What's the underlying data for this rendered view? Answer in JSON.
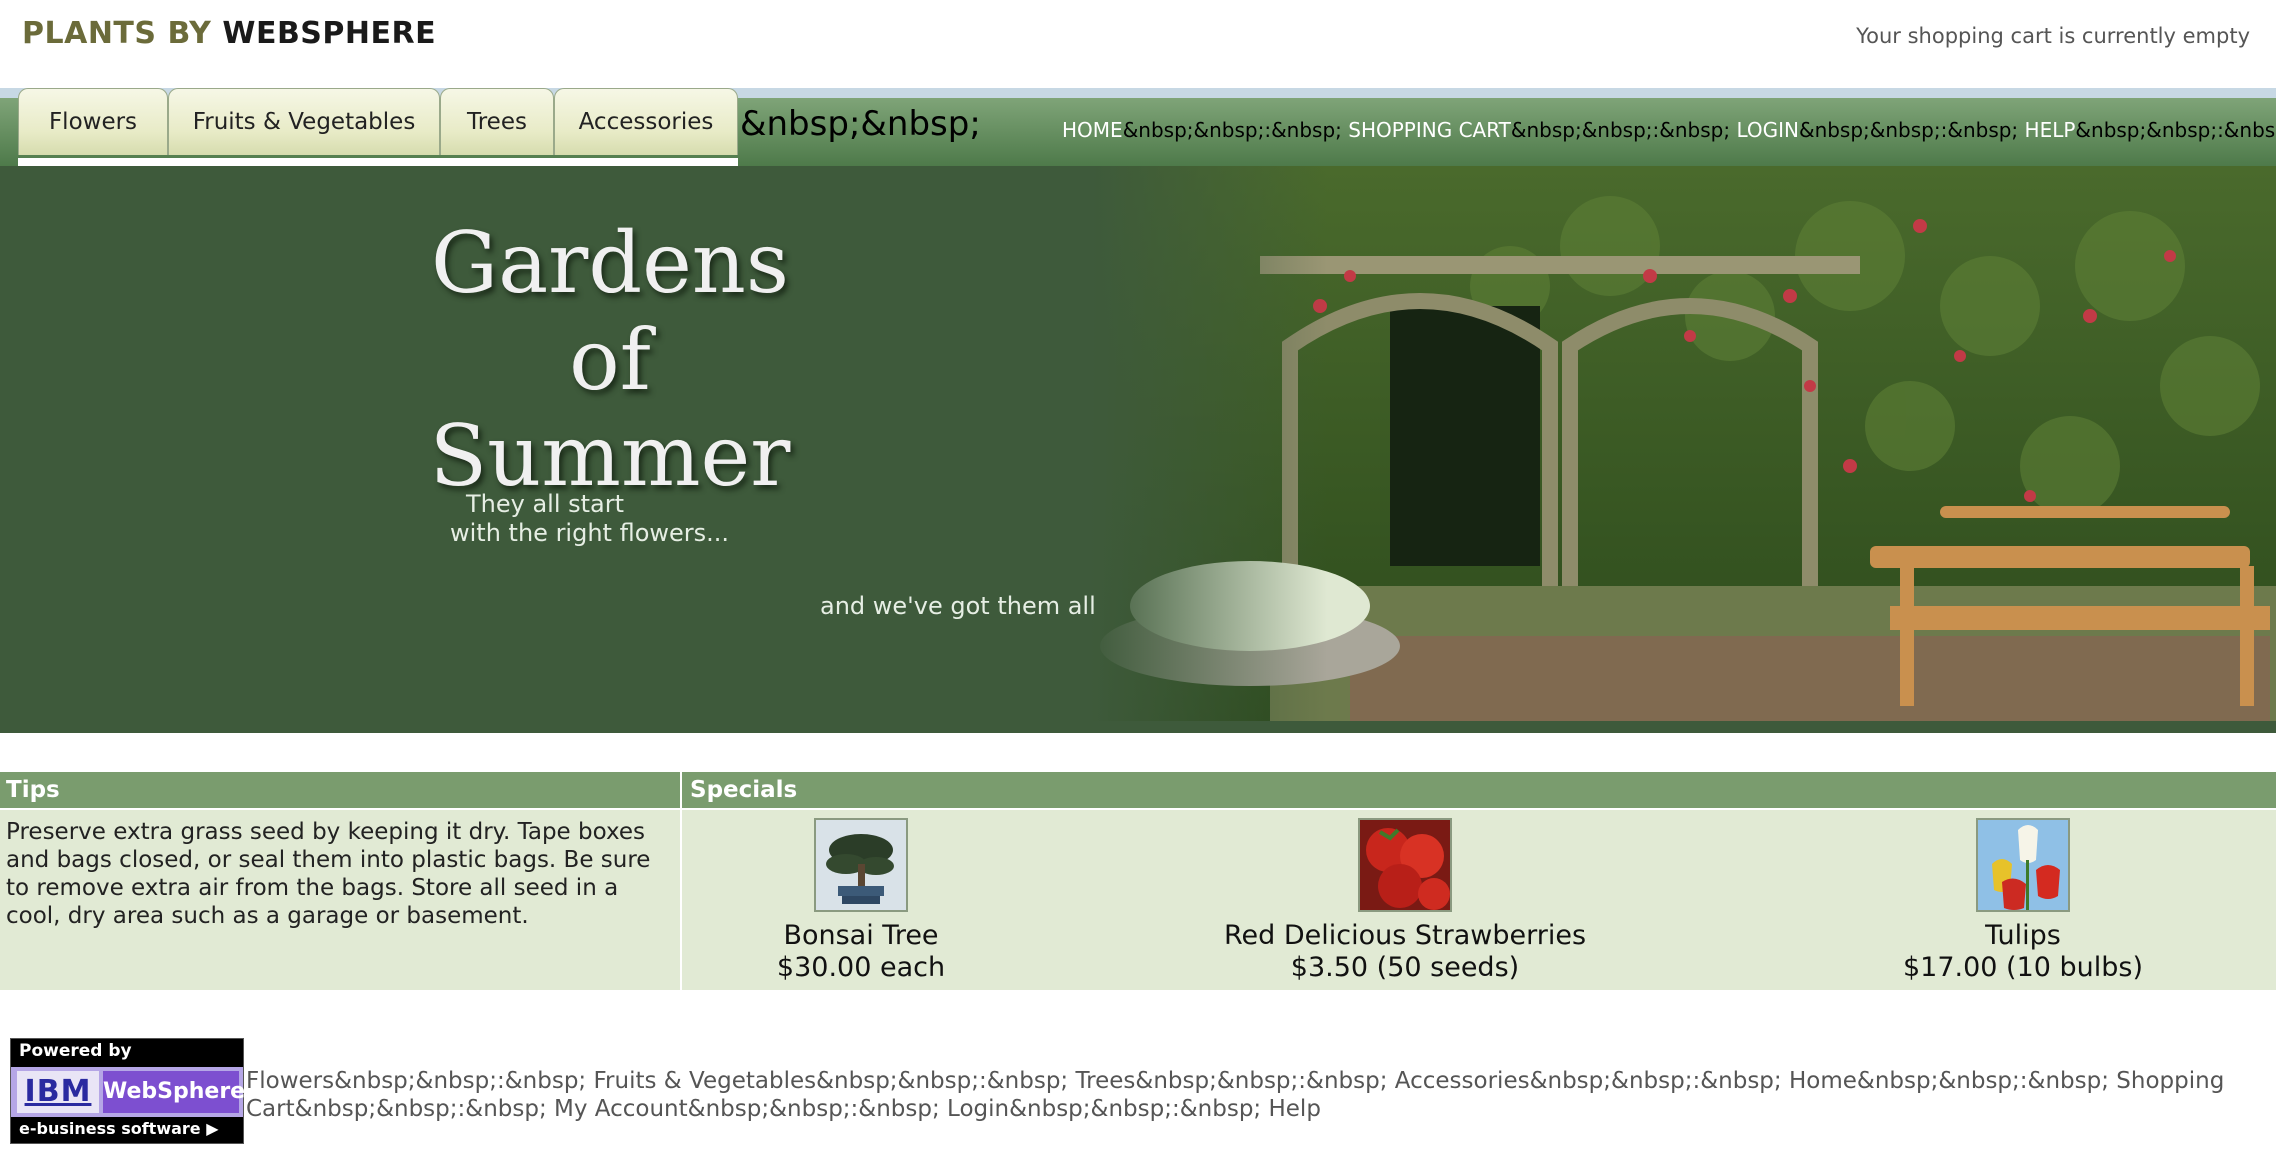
{
  "header": {
    "logo_part1": "PLANTS BY",
    "logo_part2": "WEBSPHERE",
    "cart_status": "Your shopping cart is currently empty"
  },
  "tabs": [
    {
      "label": "Flowers"
    },
    {
      "label": "Fruits & Vegetables"
    },
    {
      "label": "Trees"
    },
    {
      "label": "Accessories"
    }
  ],
  "nav_spacer_text": "&nbsp;&nbsp;",
  "topnav": {
    "home": "HOME",
    "cart": "SHOPPING CART",
    "login": "LOGIN",
    "help": "HELP",
    "sep": "&nbsp;&nbsp;:&nbsp; ",
    "trailing_sep": "&nbsp;&nbsp;:&nbsp;"
  },
  "banner": {
    "title_line1": "Gardens",
    "title_line2": "of Summer",
    "sub_line1": "They all start",
    "sub_line2": "with the right flowers...",
    "sub_line3": "and we've got them all"
  },
  "tips": {
    "heading": "Tips",
    "text": "Preserve extra grass seed by keeping it dry. Tape boxes and bags closed, or seal them into plastic bags. Be sure to remove extra air from the bags. Store all seed in a cool, dry area such as a garage or basement."
  },
  "specials": {
    "heading": "Specials",
    "items": [
      {
        "name": "Bonsai Tree",
        "price": "$30.00 each"
      },
      {
        "name": "Red Delicious Strawberries",
        "price": "$3.50 (50 seeds)"
      },
      {
        "name": "Tulips",
        "price": "$17.00 (10 bulbs)"
      }
    ]
  },
  "footer": {
    "powered_by": "Powered by",
    "ibm": "IBM",
    "websphere": "WebSphere",
    "ebusiness": "e-business software",
    "links": "Flowers&nbsp;&nbsp;:&nbsp; Fruits & Vegetables&nbsp;&nbsp;:&nbsp; Trees&nbsp;&nbsp;:&nbsp; Accessories&nbsp;&nbsp;:&nbsp; Home&nbsp;&nbsp;:&nbsp; Shopping Cart&nbsp;&nbsp;:&nbsp; My Account&nbsp;&nbsp;:&nbsp; Login&nbsp;&nbsp;:&nbsp; Help"
  },
  "colors": {
    "nav_green": "#5e8a58",
    "banner_green": "#3e5a3b",
    "section_head": "#7a9c6e",
    "section_body": "#e1ead4"
  }
}
